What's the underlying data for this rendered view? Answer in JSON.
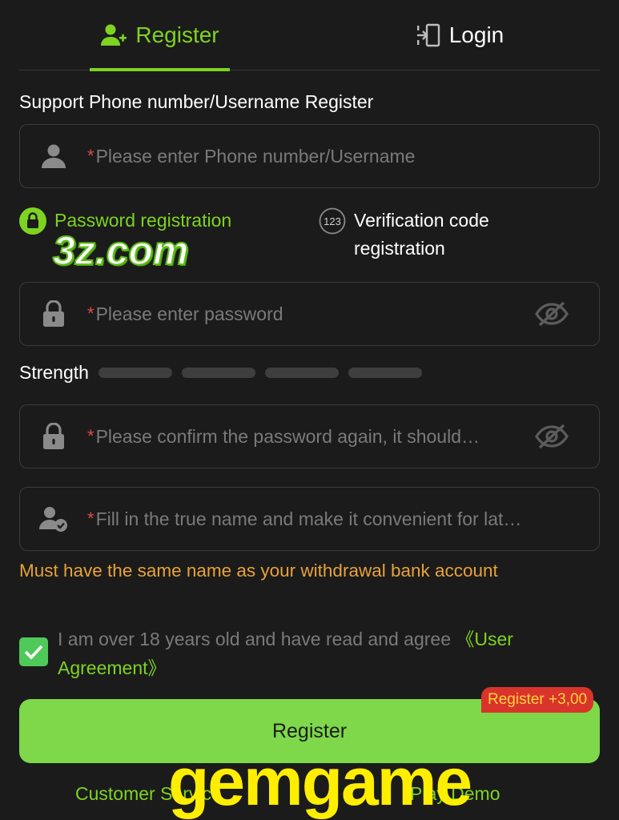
{
  "tabs": {
    "register": "Register",
    "login": "Login"
  },
  "section_label": "Support Phone number/Username Register",
  "fields": {
    "username": {
      "required_mark": "*",
      "placeholder": "Please enter Phone number/Username",
      "value": ""
    },
    "password": {
      "required_mark": "*",
      "placeholder": "Please enter password",
      "value": ""
    },
    "confirm_password": {
      "required_mark": "*",
      "placeholder": "Please confirm the password again, it should…",
      "value": ""
    },
    "real_name": {
      "required_mark": "*",
      "placeholder": "Fill in the true name and make it convenient for lat…",
      "value": ""
    }
  },
  "modes": {
    "password_registration": "Password registration",
    "verification_code_icon_text": "123",
    "verification_code_registration": "Verification code registration"
  },
  "watermark_top": "3z.com",
  "strength": {
    "label": "Strength",
    "level": 0,
    "segments": 4
  },
  "name_warning": "Must have the same name as your withdrawal bank account",
  "agreement": {
    "checked": true,
    "text": "I am over 18 years old and have read and agree",
    "link": "《User Agreement》"
  },
  "register_button": "Register",
  "bonus_badge": "Register +3,00",
  "footer": {
    "customer_service": "Customer Service",
    "play_demo": "Play Demo"
  },
  "watermark_bottom": "gemgame",
  "colors": {
    "background": "#1b1b1b",
    "accent_green": "#7ed321",
    "button_green": "#7ed84a",
    "warning_orange": "#e8a23a",
    "badge_red": "#d9342b",
    "badge_text": "#ffd33d",
    "required_red": "#e04a4a"
  },
  "icons": {
    "register_tab": "user-plus-icon",
    "login_tab": "login-door-icon",
    "username_field": "user-icon",
    "password_field": "lock-icon",
    "confirm_field": "lock-icon",
    "name_field": "user-check-icon",
    "password_toggle": "eye-off-icon",
    "password_mode": "lock-circle-icon",
    "checkbox": "checkmark-icon"
  }
}
